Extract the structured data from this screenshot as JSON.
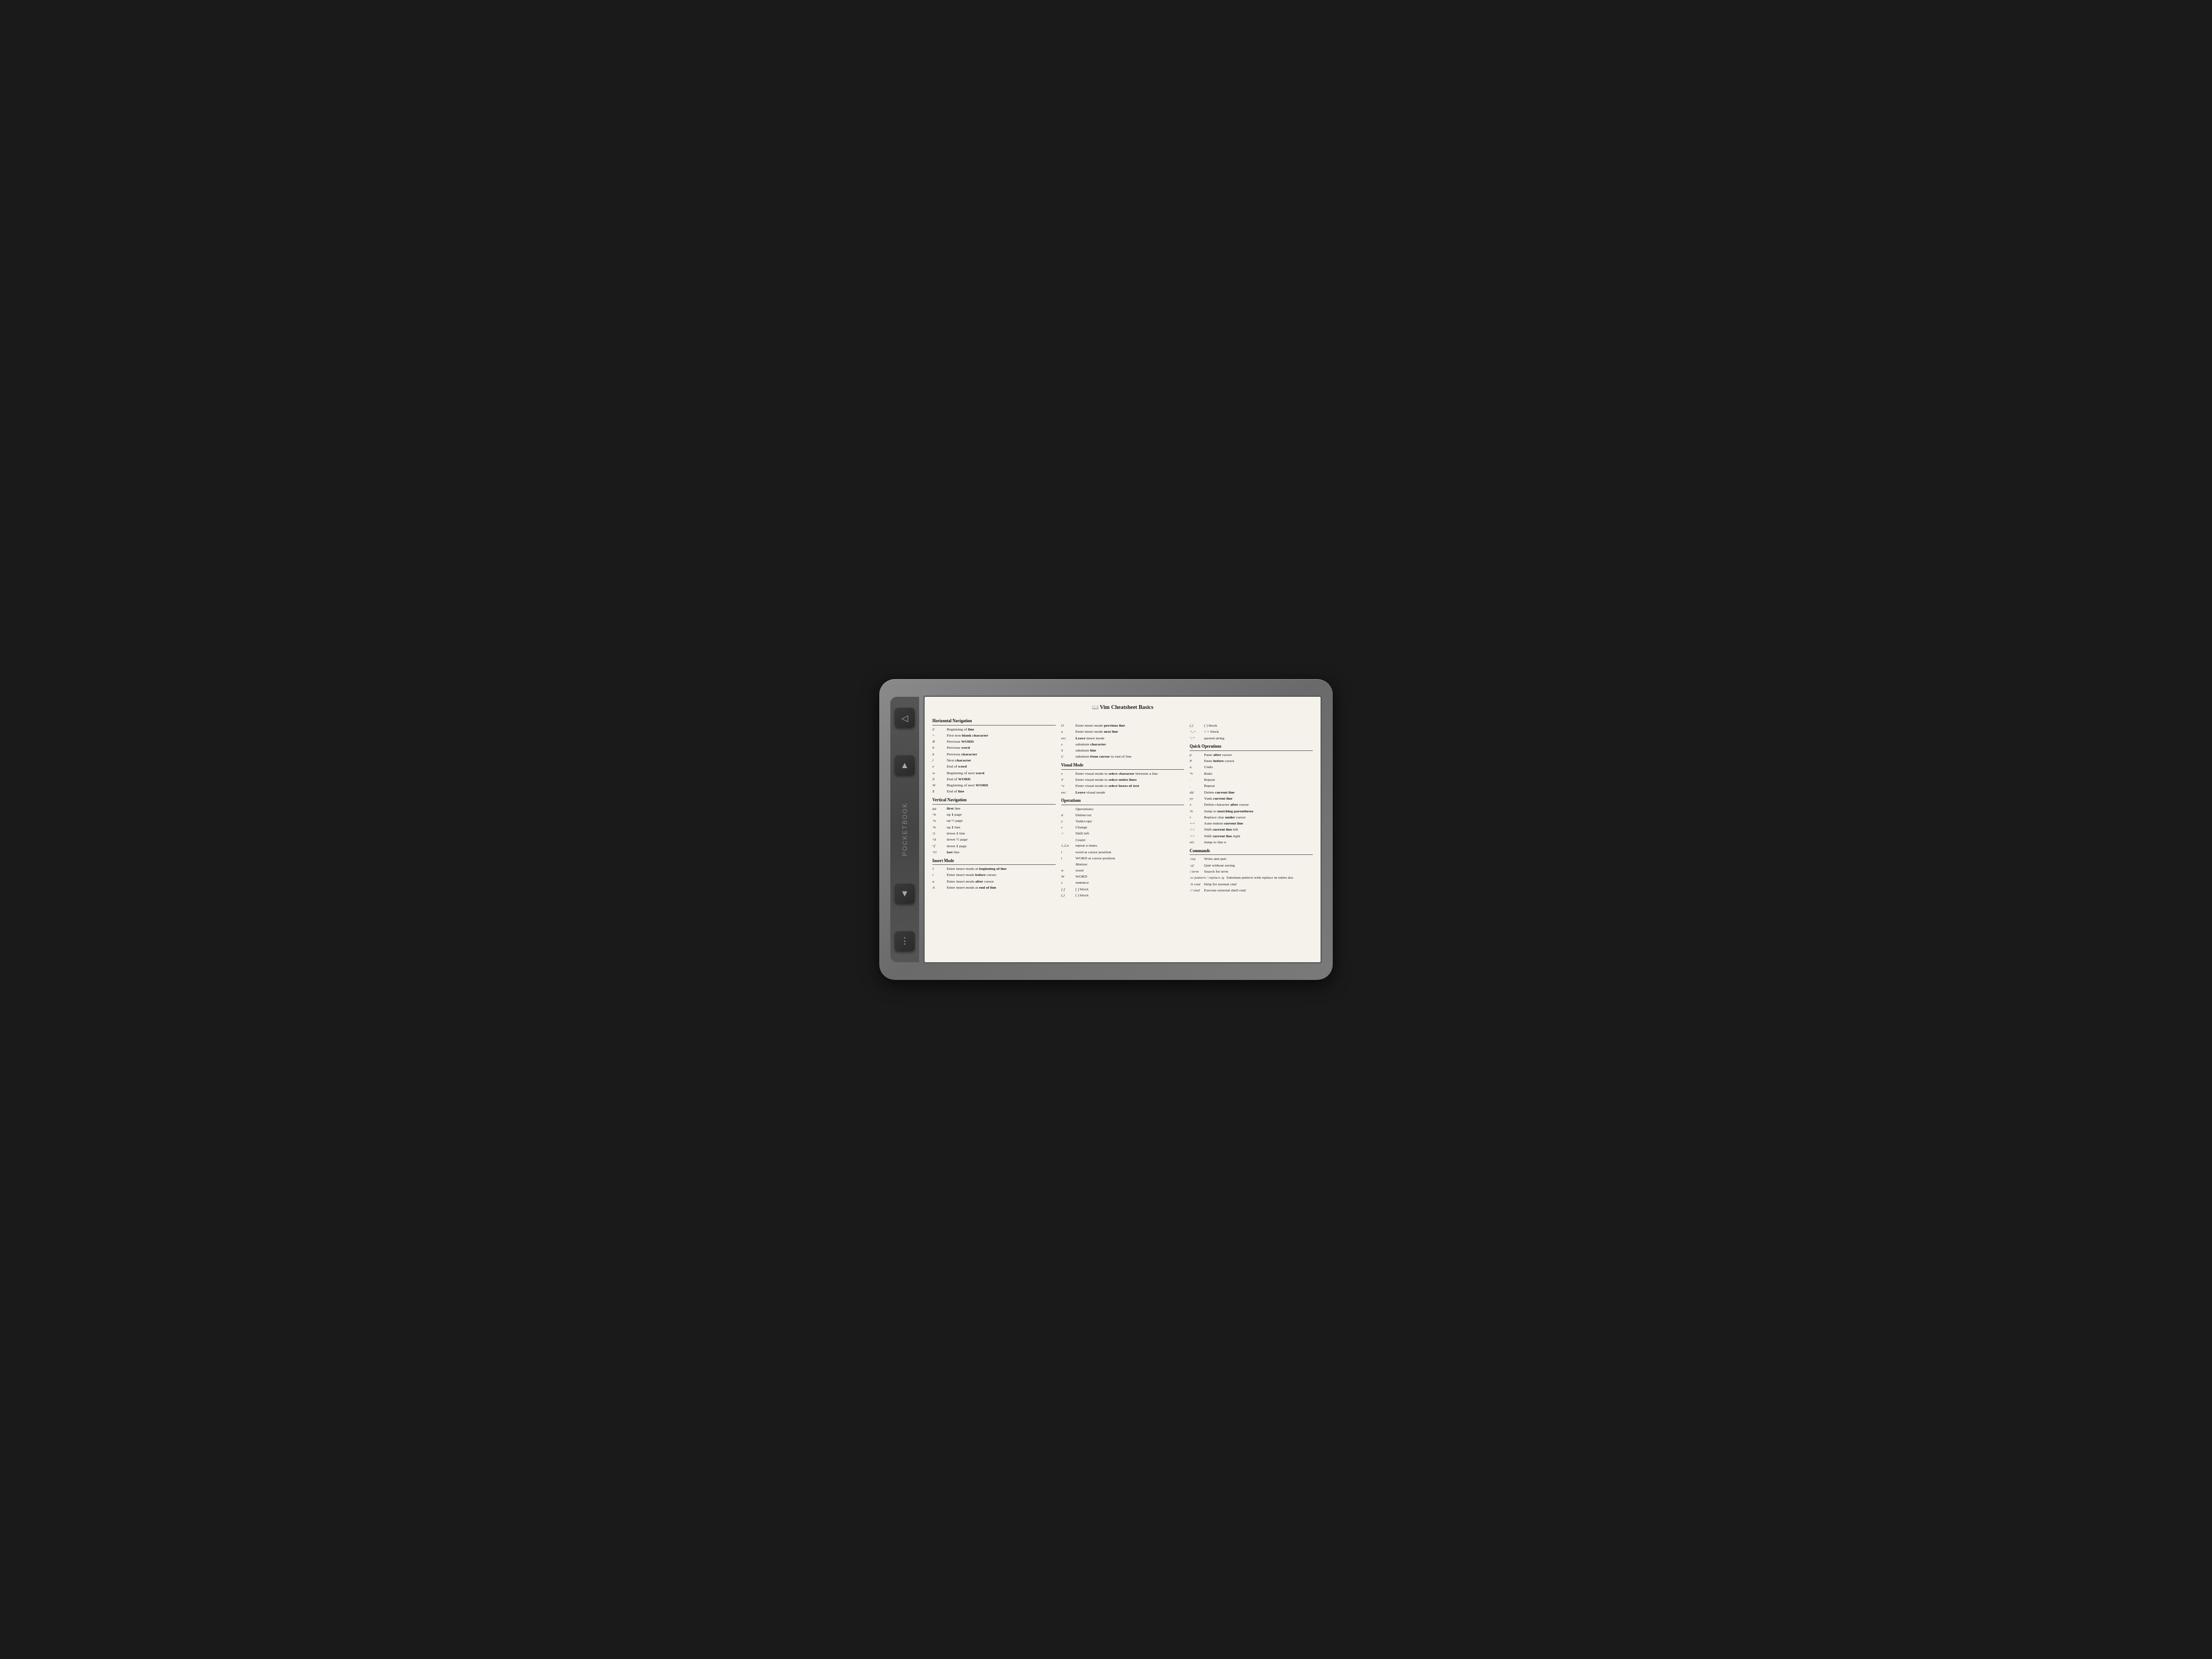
{
  "device": {
    "brand": "PocketBook"
  },
  "cheatsheet": {
    "title": "📖 Vim Cheatsheet Basics",
    "col1": {
      "sections": [
        {
          "title": "Horizontal Navigation",
          "entries": [
            {
              "key": "0",
              "desc": "Beginning of <b>line</b>"
            },
            {
              "key": "^",
              "desc": "First non-<b>blank character</b>"
            },
            {
              "key": "B",
              "desc": "Previous <b>WORD</b>"
            },
            {
              "key": "b",
              "desc": "Previous <b>word</b>"
            },
            {
              "key": "h",
              "desc": "Previous <b>character</b>"
            },
            {
              "key": "l",
              "desc": "Next <b>character</b>"
            },
            {
              "key": "e",
              "desc": "End of <b>word</b>"
            },
            {
              "key": "w",
              "desc": "Beginning of next <b>word</b>"
            },
            {
              "key": "E",
              "desc": "End of <b>WORD</b>"
            },
            {
              "key": "W",
              "desc": "Beginning of next <b>WORD</b>"
            },
            {
              "key": "$",
              "desc": "End of <b>line</b>"
            }
          ]
        },
        {
          "title": "Vertical Navigation",
          "entries": [
            {
              "key": "gg",
              "desc": "<b>first</b> line"
            },
            {
              "key": "^b",
              "desc": "up <b>1</b> page"
            },
            {
              "key": "^u",
              "desc": "up <b>½</b> page"
            },
            {
              "key": "^k",
              "desc": "up <b>1</b> line"
            },
            {
              "key": "^j",
              "desc": "down <b>1</b> line"
            },
            {
              "key": "^d",
              "desc": "down <b>½</b> page"
            },
            {
              "key": "^f",
              "desc": "down <b>1</b> page"
            },
            {
              "key": "^G",
              "desc": "<b>last</b> line"
            }
          ]
        },
        {
          "title": "Insert Mode",
          "entries": [
            {
              "key": "I",
              "desc": "Enter insert mode at <b>beginning of line</b>"
            },
            {
              "key": "i",
              "desc": "Enter insert mode <b>before</b> cursor"
            },
            {
              "key": "a",
              "desc": "Enter insert mode <b>after</b> cursor"
            },
            {
              "key": "A",
              "desc": "Enter insert mode at <b>end of line</b>"
            }
          ]
        }
      ]
    },
    "col2": {
      "sections": [
        {
          "title": "",
          "entries": [
            {
              "key": "O",
              "desc": "Enter insert mode <b>previous line</b>"
            },
            {
              "key": "o",
              "desc": "Enter insert mode <b>next line</b>"
            },
            {
              "key": "esc",
              "desc": "<b>Leave</b> insert mode"
            },
            {
              "key": "s",
              "desc": "subsitute <b>character</b>"
            },
            {
              "key": "S",
              "desc": "subsitute <b>line</b>"
            },
            {
              "key": "C",
              "desc": "subsitute <b>from cursor</b> to end of line"
            }
          ]
        },
        {
          "title": "Visual Mode",
          "entries": [
            {
              "key": "v",
              "desc": "Enter visual mode to <b>select character</b> between a line"
            },
            {
              "key": "V",
              "desc": "Enter visual mode to <b>select entire lines</b>"
            },
            {
              "key": "^v",
              "desc": "Enter visual mode to <b>select boxes of text</b>"
            },
            {
              "key": "esc",
              "desc": "<b>Leave</b> visual mode"
            }
          ]
        },
        {
          "title": "Operations",
          "entries": [
            {
              "key": "",
              "desc": "<em>Operations:</em>"
            },
            {
              "key": "d",
              "desc": "Delete/cut"
            },
            {
              "key": "y",
              "desc": "Yank/copy"
            },
            {
              "key": "c",
              "desc": "Change"
            },
            {
              "key": "<",
              "desc": "Shift left"
            },
            {
              "key": "",
              "desc": "<em>Count:</em>"
            },
            {
              "key": "1,2,n",
              "desc": "repeat n times"
            },
            {
              "key": "i",
              "desc": "word at cursor position"
            },
            {
              "key": "i",
              "desc": "WORD at cursor position"
            },
            {
              "key": "",
              "desc": "<em>Motion:</em>"
            },
            {
              "key": "w",
              "desc": "word"
            },
            {
              "key": "W",
              "desc": "WORD"
            },
            {
              "key": "s",
              "desc": "sentence"
            },
            {
              "key": "[,]",
              "desc": "[ ] block"
            },
            {
              "key": "(,)",
              "desc": "( ) block"
            }
          ]
        }
      ]
    },
    "col3": {
      "sections": [
        {
          "title": "",
          "entries": [
            {
              "key": "(,)",
              "desc": "( ) block"
            },
            {
              "key": "<,>",
              "desc": "< > block"
            },
            {
              "key": "\",\\'",
              "desc": "quoted string"
            }
          ]
        },
        {
          "title": "Quick Operations",
          "entries": [
            {
              "key": "p",
              "desc": "Paste <b>after</b> cursor"
            },
            {
              "key": "P",
              "desc": "Paste <b>before</b> cursor"
            },
            {
              "key": "u",
              "desc": "Undo"
            },
            {
              "key": "*r",
              "desc": "Redo"
            },
            {
              "key": ".",
              "desc": "Repeat"
            },
            {
              "key": ".",
              "desc": "Repeat"
            },
            {
              "key": "dd",
              "desc": "Delete <b>current line</b>"
            },
            {
              "key": "yy",
              "desc": "Yank <b>current line</b>"
            },
            {
              "key": "x",
              "desc": "Delete character <b>after</b> cursor"
            },
            {
              "key": "%",
              "desc": "Jump to <b>matching parentheses</b>"
            },
            {
              "key": "r",
              "desc": "Replace char <b>under</b> cursor"
            },
            {
              "key": "==",
              "desc": "Auto-indent <b>current line</b>"
            },
            {
              "key": "<<",
              "desc": "Shift <b>current line</b> left"
            },
            {
              "key": ">>",
              "desc": "Shift <b>current line</b> right"
            },
            {
              "key": "nG",
              "desc": "Jump to line n"
            }
          ]
        },
        {
          "title": "Commands",
          "entries": [
            {
              "key": ":wq",
              "desc": "Write and quit"
            },
            {
              "key": ":q!",
              "desc": "Quit without saving"
            },
            {
              "key": "/ term",
              "desc": "Search for <em>term</em>"
            },
            {
              "key": ":s/ pattern / replace /g",
              "desc": "Subsitute <em>pattern</em> with <em>replace</em> in entire doc"
            },
            {
              "key": ":h cmd",
              "desc": "Help for normal <em>cmd</em>"
            },
            {
              "key": ":! cmd",
              "desc": "Execute external shell <em>cmd</em>"
            }
          ]
        }
      ]
    }
  }
}
